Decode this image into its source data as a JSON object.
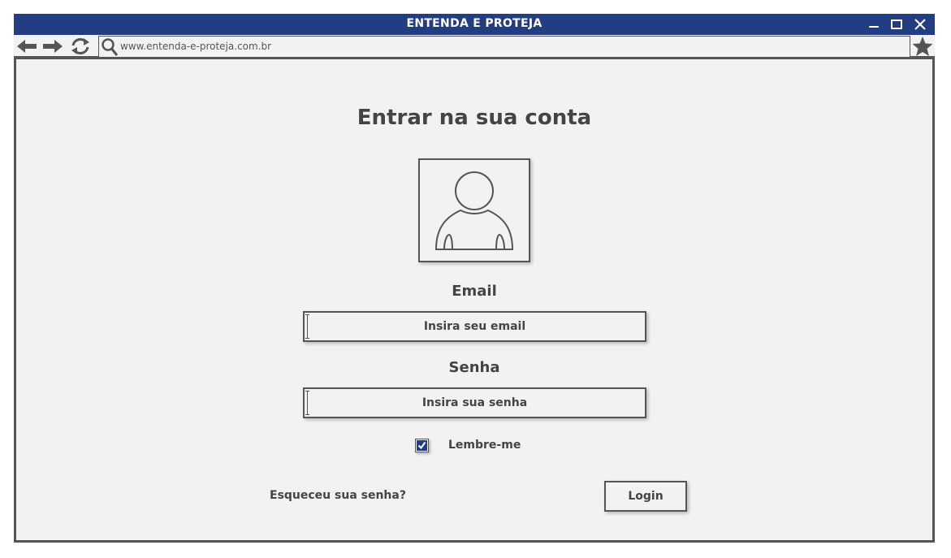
{
  "window": {
    "title": "ENTENDA E PROTEJA",
    "controls": [
      "minimize-icon",
      "maximize-icon",
      "close-icon"
    ]
  },
  "browser": {
    "url": "www.entenda-e-proteja.com.br",
    "icons": [
      "arrow-left-icon",
      "arrow-right-icon",
      "refresh-icon",
      "search-icon",
      "star-icon"
    ]
  },
  "login": {
    "heading": "Entrar na sua conta",
    "avatar_icon": "user-icon",
    "email_label": "Email",
    "email_placeholder": "Insira seu email",
    "password_label": "Senha",
    "password_placeholder": "Insira sua senha",
    "remember_label": "Lembre-me",
    "remember_checked": true,
    "forgot_label": "Esqueceu sua senha?",
    "login_label": "Login"
  },
  "colors": {
    "titlebar": "#233d82",
    "text": "#444444",
    "border": "#555555",
    "background": "#f2f2f2",
    "checkbox_accent": "#233d82"
  }
}
